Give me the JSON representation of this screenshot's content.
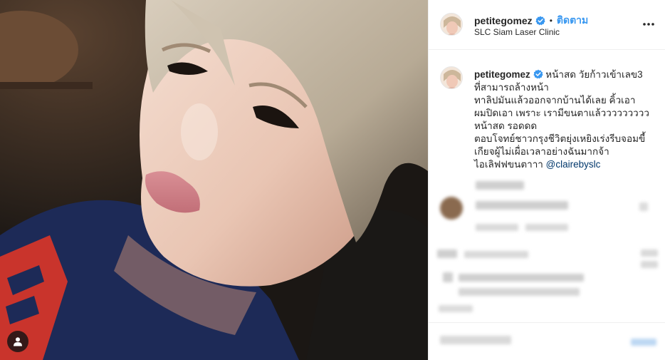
{
  "post": {
    "username": "petitegomez",
    "follow_label": "ติดตาม",
    "separator": "•",
    "location": "SLC Siam Laser Clinic",
    "caption": {
      "username": "petitegomez",
      "lines": [
        "หน้าสด วัยก้าวเข้าเลข3",
        "ที่สามารถล้างหน้า",
        "ทาลิปมันแล้วออกจากบ้านได้เลย คิ้วเอา",
        "ผมปิดเอา เพราะ เรามีขนตาแล้ววววววววว",
        "หน้าสด รอดดด",
        "ตอบโจทย์ชาวกรุงชีวิตยุ่งเหยิงเร่งรีบจอมขี้",
        "เกียจผู้ไม่เผื่อเวลาอย่างฉันมากจ้า",
        "ไอเลิฟฟขนตาาา"
      ],
      "mention": "@clairebyslc"
    }
  },
  "icons": {
    "verified": "verified-badge-icon",
    "more": "more-options-icon",
    "tag": "user-tag-icon"
  },
  "colors": {
    "link": "#3897f0",
    "verified": "#3897f0",
    "mention": "#00376b"
  }
}
